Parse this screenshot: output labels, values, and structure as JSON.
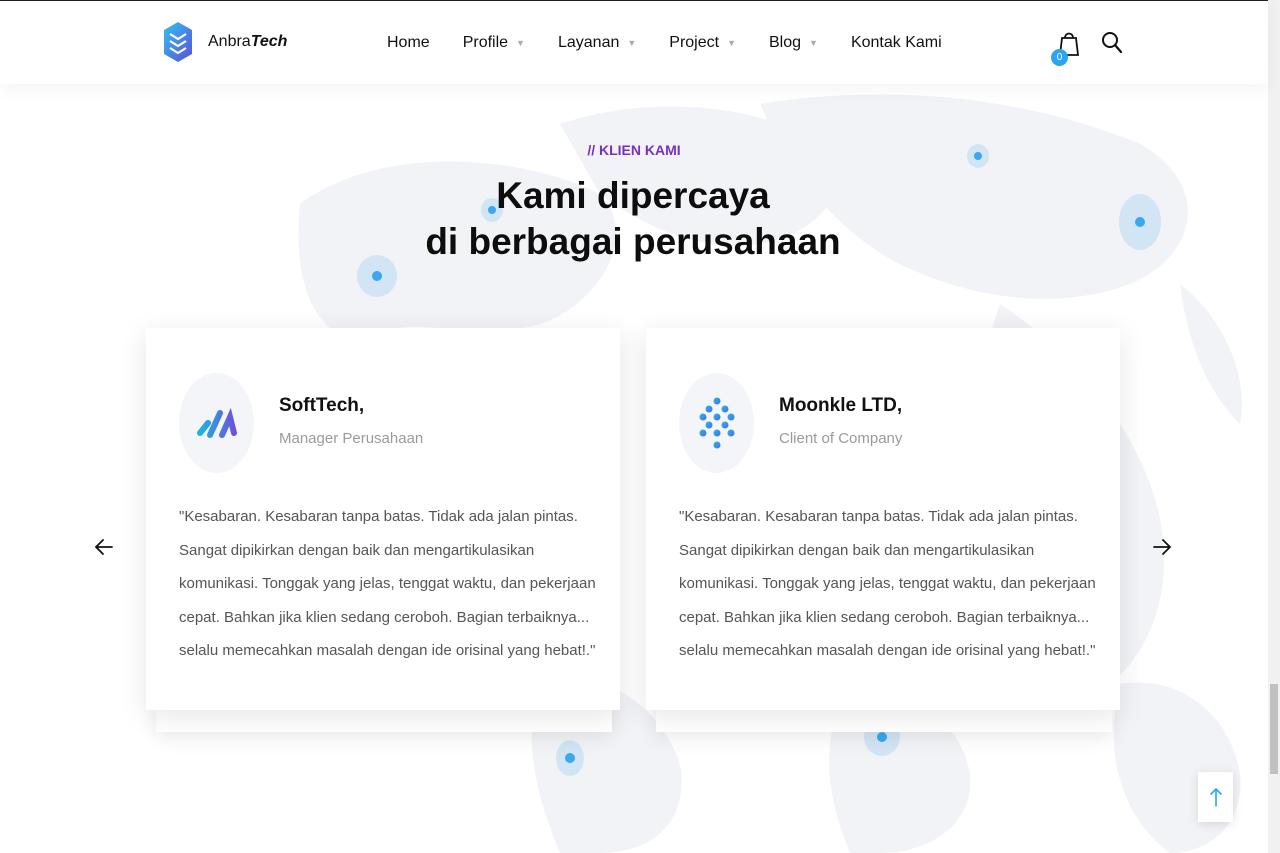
{
  "header": {
    "logo": {
      "text_regular": "Anbra",
      "text_bold": "Tech"
    },
    "nav": [
      {
        "label": "Home",
        "has_dropdown": false
      },
      {
        "label": "Profile",
        "has_dropdown": true
      },
      {
        "label": "Layanan",
        "has_dropdown": true
      },
      {
        "label": "Project",
        "has_dropdown": true
      },
      {
        "label": "Blog",
        "has_dropdown": true
      },
      {
        "label": "Kontak Kami",
        "has_dropdown": false
      }
    ],
    "cart_count": "0",
    "icons": {
      "cart": "shopping-bag-icon",
      "search": "search-icon"
    }
  },
  "section": {
    "eyebrow": "// KLIEN KAMI",
    "heading_line1": "Kami dipercaya",
    "heading_line2": "di berbagai perusahaan"
  },
  "testimonials": [
    {
      "name": "SoftTech,",
      "role": "Manager Perusahaan",
      "quote": "\"Kesabaran. Kesabaran tanpa batas. Tidak ada jalan pintas. Sangat dipikirkan dengan baik dan mengartikulasikan komunikasi. Tonggak yang jelas, tenggat waktu, dan pekerjaan cepat. Bahkan jika klien sedang ceroboh. Bagian terbaiknya... selalu memecahkan masalah dengan ide orisinal yang hebat!.\""
    },
    {
      "name": "Moonkle LTD,",
      "role": "Client of Company",
      "quote": "\"Kesabaran. Kesabaran tanpa batas. Tidak ada jalan pintas. Sangat dipikirkan dengan baik dan mengartikulasikan komunikasi. Tonggak yang jelas, tenggat waktu, dan pekerjaan cepat. Bahkan jika klien sedang ceroboh. Bagian terbaiknya... selalu memecahkan masalah dengan ide orisinal yang hebat!.\""
    }
  ],
  "colors": {
    "accent": "#7a2fc3",
    "brand_blue": "#2aa6f0",
    "map": "#f3f4f7"
  }
}
